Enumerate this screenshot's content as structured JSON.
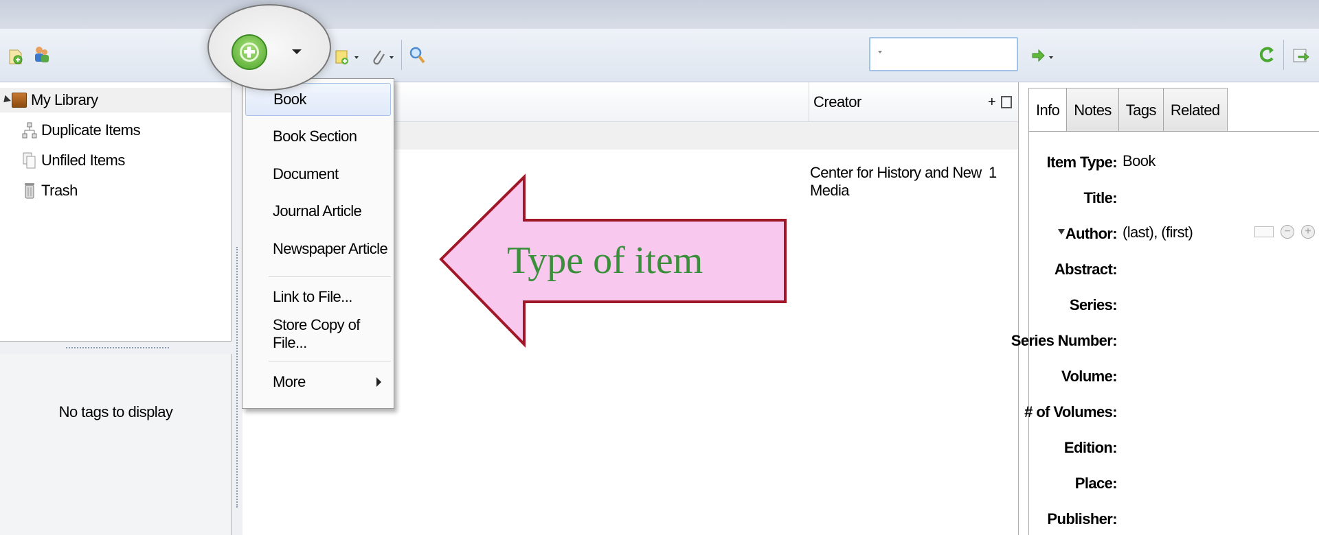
{
  "colors": {
    "accent_green": "#4ea62c",
    "menu_highlight": "#dfe9f9",
    "callout_fill": "#f8c8ee",
    "callout_stroke": "#a01828",
    "callout_text": "#3a8f3a"
  },
  "toolbar": {
    "icons": [
      "new-collection-icon",
      "new-group-icon",
      "new-item-icon",
      "new-note-icon",
      "attachment-icon",
      "advanced-search-icon",
      "locate-icon",
      "sync-icon",
      "fullscreen-icon"
    ],
    "search_value": ""
  },
  "collections": {
    "items": [
      {
        "label": "My Library",
        "icon": "library-icon"
      },
      {
        "label": "Duplicate Items",
        "icon": "duplicate-icon"
      },
      {
        "label": "Unfiled Items",
        "icon": "unfiled-icon"
      },
      {
        "label": "Trash",
        "icon": "trash-icon"
      }
    ]
  },
  "tags": {
    "empty_message": "No tags to display"
  },
  "items_list": {
    "columns": {
      "creator": "Creator",
      "plus": "+"
    },
    "rows": [
      {
        "creator": "Center for History and New Media",
        "count": "1"
      }
    ]
  },
  "new_item_menu": {
    "items": [
      "Book",
      "Book Section",
      "Document",
      "Journal Article",
      "Newspaper Article"
    ],
    "file_items": [
      "Link to File...",
      "Store Copy of File..."
    ],
    "more": "More"
  },
  "item_pane": {
    "tabs": [
      "Info",
      "Notes",
      "Tags",
      "Related"
    ],
    "fields": [
      {
        "label": "Item Type:",
        "value": "Book"
      },
      {
        "label": "Title:",
        "value": ""
      },
      {
        "label": "Author:",
        "value": "(last), (first)"
      },
      {
        "label": "Abstract:",
        "value": ""
      },
      {
        "label": "Series:",
        "value": ""
      },
      {
        "label": "Series Number:",
        "value": ""
      },
      {
        "label": "Volume:",
        "value": ""
      },
      {
        "label": "# of Volumes:",
        "value": ""
      },
      {
        "label": "Edition:",
        "value": ""
      },
      {
        "label": "Place:",
        "value": ""
      },
      {
        "label": "Publisher:",
        "value": ""
      }
    ]
  },
  "annotation": {
    "text": "Type of item"
  }
}
